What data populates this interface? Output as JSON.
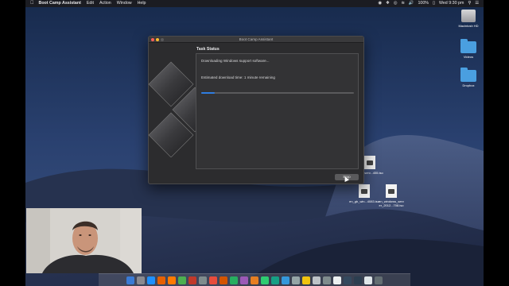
{
  "menubar": {
    "app_name": "Boot Camp Assistant",
    "items": [
      "Edit",
      "Action",
      "Window",
      "Help"
    ],
    "battery": "100%",
    "clock": "Wed 9:30 pm"
  },
  "desktop_icons": [
    {
      "label": "Macintosh HD",
      "icon": "hard-drive-icon"
    },
    {
      "label": "Videos",
      "icon": "folder-icon"
    },
    {
      "label": "Dropbox",
      "icon": "folder-icon"
    },
    {
      "label": "en_...serv...455.iso",
      "icon": "disk-image-icon"
    },
    {
      "label": "en_gb_win...4083.iso",
      "icon": "disk-image-icon"
    },
    {
      "label": "en_windows_serv er_2012...708.iso",
      "icon": "disk-image-icon"
    }
  ],
  "window": {
    "title": "Boot Camp Assistant",
    "section_title": "Task Status",
    "status_line": "Downloading Windows support software...",
    "time_line": "Estimated download time: 1 minute remaining",
    "progress": 0.09,
    "stop_label": "Stop"
  },
  "colors": {
    "accent": "#2f7de1",
    "window_bg": "#2c2c2e"
  }
}
